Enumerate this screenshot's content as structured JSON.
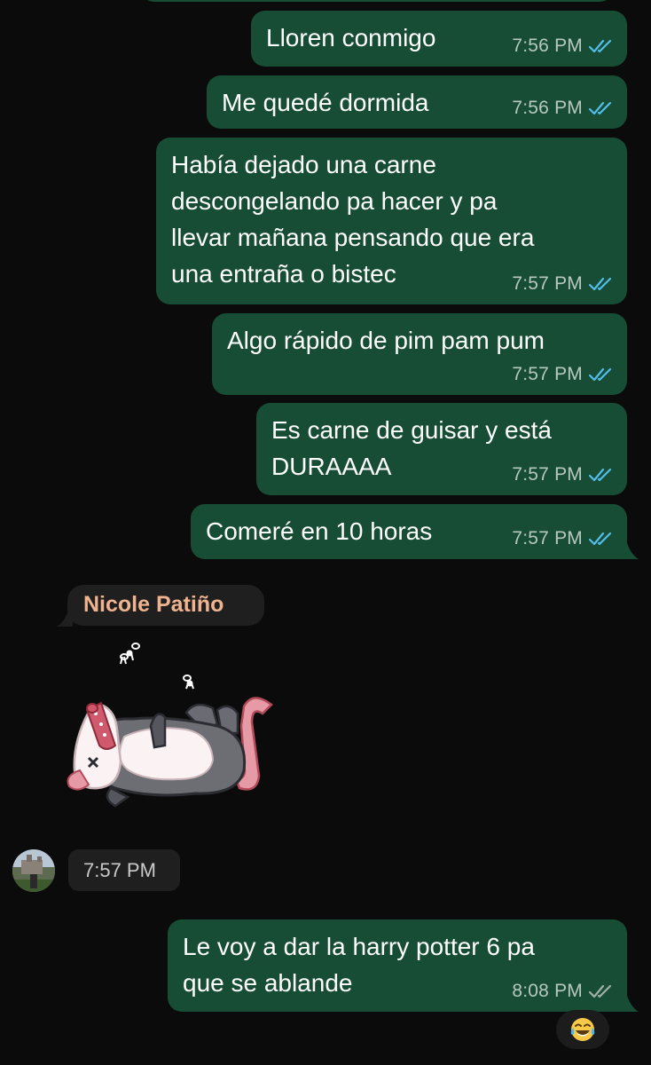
{
  "messages": [
    {
      "lines": [
        "Lloren conmigo"
      ],
      "time": "7:56 PM",
      "status": "read"
    },
    {
      "lines": [
        "Me quedé dormida"
      ],
      "time": "7:56 PM",
      "status": "read"
    },
    {
      "lines": [
        "Había dejado una carne",
        "descongelando pa hacer y pa",
        "llevar mañana pensando que era",
        "una entraña o bistec"
      ],
      "time": "7:57 PM",
      "status": "read"
    },
    {
      "lines": [
        "Algo rápido de pim pam pum"
      ],
      "time": "7:57 PM",
      "status": "read"
    },
    {
      "lines": [
        "Es carne de guisar y está",
        "DURAAAA"
      ],
      "time": "7:57 PM",
      "status": "read"
    },
    {
      "lines": [
        "Comeré en 10 horas"
      ],
      "time": "7:57 PM",
      "status": "read"
    },
    {
      "lines": [
        "Le voy a dar la harry potter 6 pa",
        "que se ablande"
      ],
      "time": "8:08 PM",
      "status": "delivered"
    }
  ],
  "incoming": {
    "sender_name": "Nicole Patiño",
    "sticker_icon": "opossum-playing-dead-sticker",
    "time": "7:57 PM"
  },
  "reaction": {
    "icon": "tears-of-joy-emoji"
  },
  "colors": {
    "background": "#0b0b0b",
    "outgoing_bubble": "#174d34",
    "incoming_pill": "#1f1f1f",
    "sender_name": "#efb38f",
    "read_ticks": "#53bdeb",
    "delivered_ticks": "#9fb0a8"
  }
}
